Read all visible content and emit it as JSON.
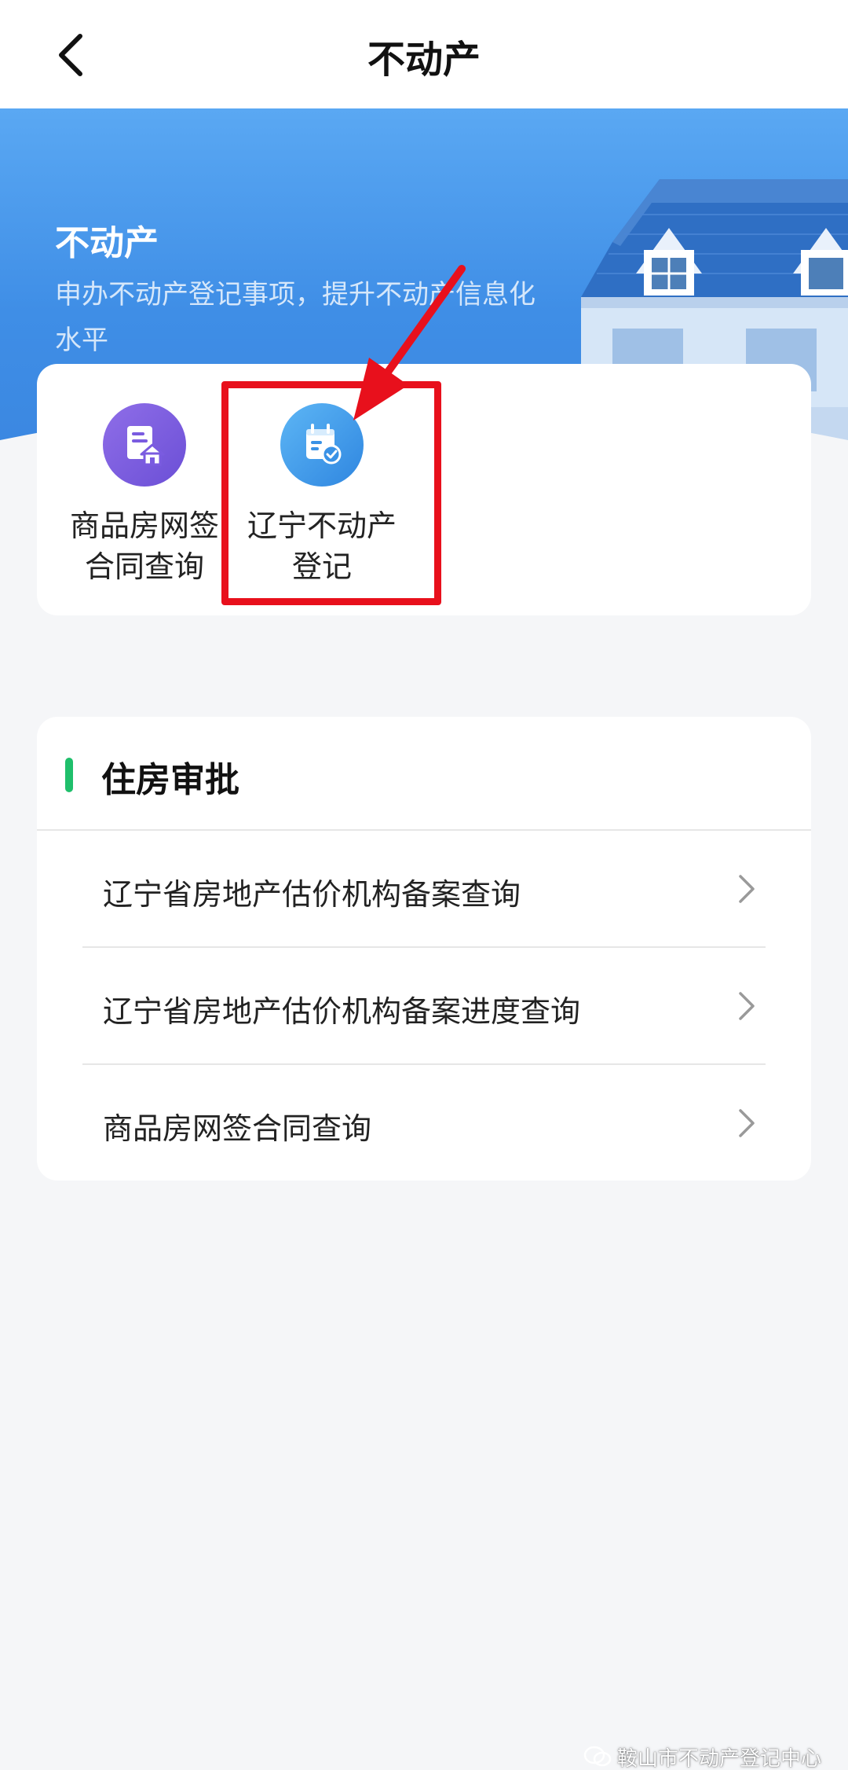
{
  "navbar": {
    "title": "不动产",
    "back_icon": "chevron-left-icon"
  },
  "hero": {
    "title": "不动产",
    "description": "申办不动产登记事项，提升不动产信息化水平"
  },
  "quick_services": [
    {
      "label": "商品房网签\n合同查询",
      "icon": "contract-house-icon",
      "color": "#7a5be0"
    },
    {
      "label": "辽宁不动产\n登记",
      "icon": "registration-calendar-icon",
      "color": "#3a92e6"
    }
  ],
  "section": {
    "title": "住房审批",
    "accent_color": "#1fbf6b",
    "items": [
      {
        "label": "辽宁省房地产估价机构备案查询"
      },
      {
        "label": "辽宁省房地产估价机构备案进度查询"
      },
      {
        "label": "商品房网签合同查询"
      }
    ]
  },
  "annotation": {
    "color": "#e8101c"
  },
  "watermark": {
    "text": "鞍山市不动产登记中心",
    "icon": "wechat-icon"
  }
}
